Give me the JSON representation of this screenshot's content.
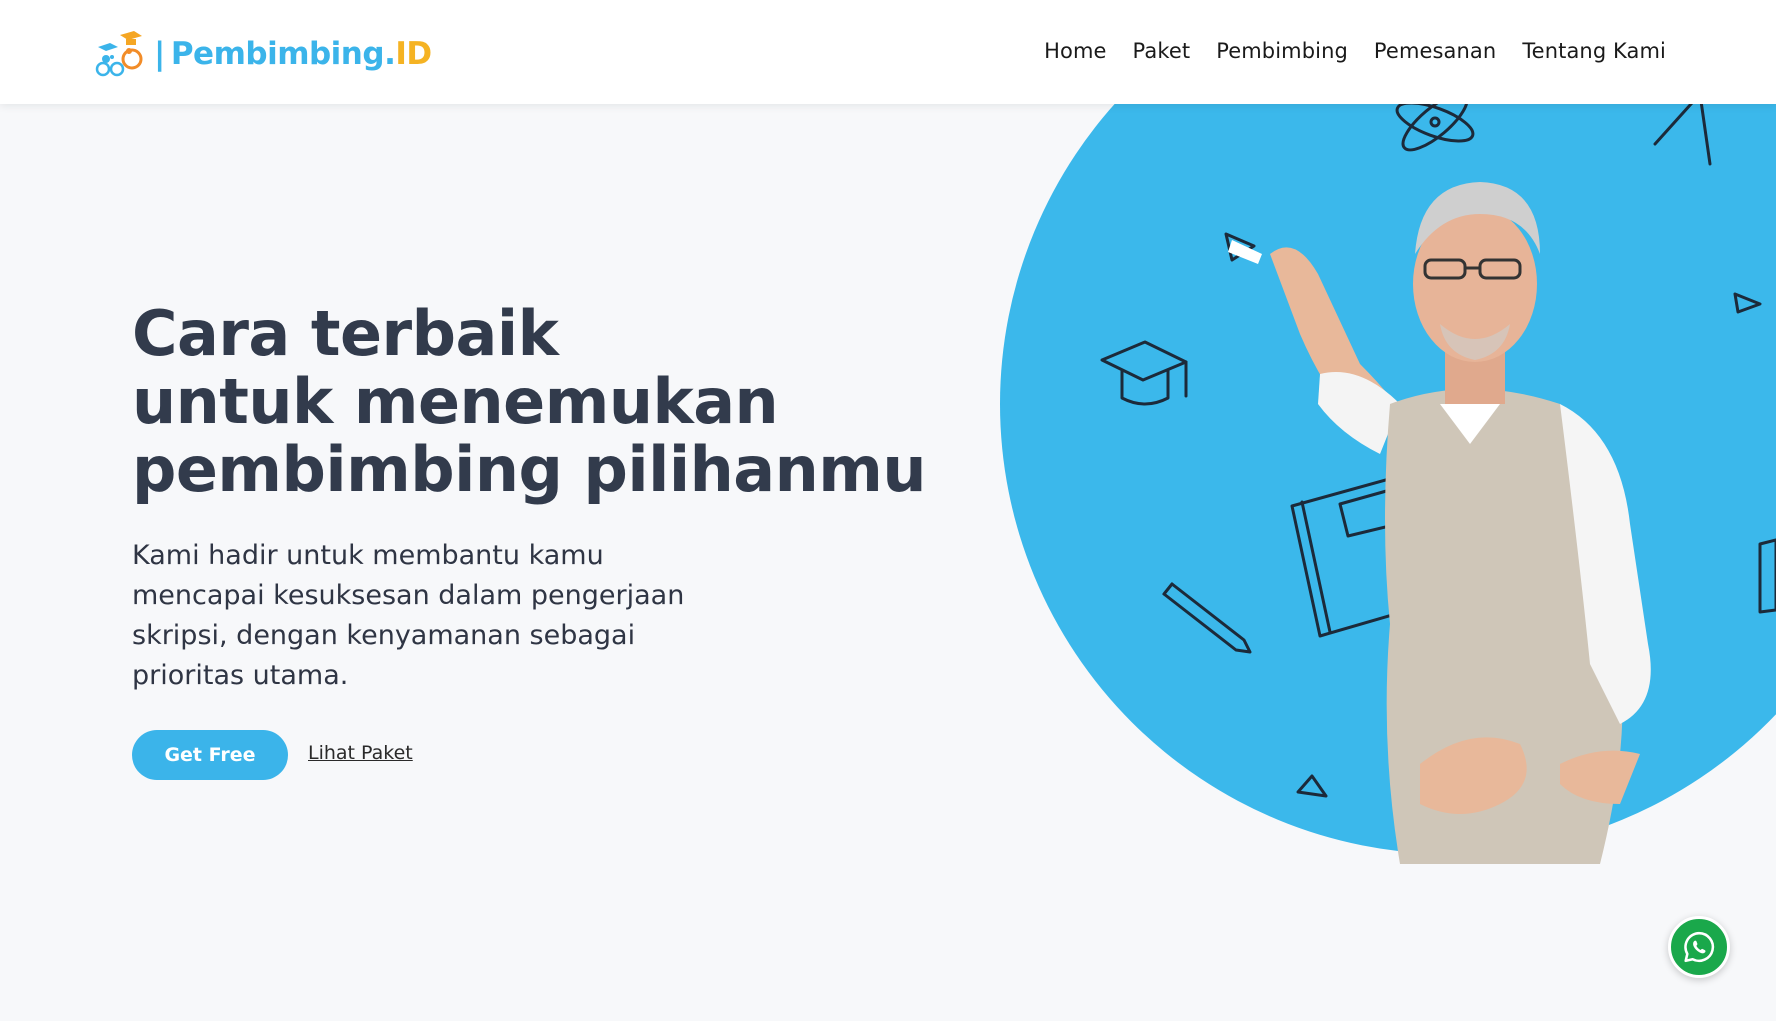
{
  "header": {
    "logo_text": "Pembimbing.",
    "logo_suffix": "ID",
    "logo_divider": "|",
    "nav": [
      {
        "label": "Home"
      },
      {
        "label": "Paket"
      },
      {
        "label": "Pembimbing"
      },
      {
        "label": "Pemesanan"
      },
      {
        "label": "Tentang Kami"
      }
    ]
  },
  "hero": {
    "title_lines": [
      "Cara terbaik",
      "untuk menemukan",
      "pembimbing pilihanmu"
    ],
    "subtitle": "Kami hadir untuk membantu kamu mencapai kesuksesan dalam pengerjaan skripsi, dengan kenyamanan sebagai prioritas utama.",
    "primary_button": "Get Free",
    "secondary_link": "Lihat Paket"
  },
  "colors": {
    "brand_blue": "#3bb4ea",
    "brand_yellow": "#f5b323",
    "heading": "#323b4c",
    "whatsapp": "#1aa84b"
  },
  "icons": {
    "whatsapp_button": "whatsapp-icon",
    "logo": "mascot-logo-icon"
  }
}
